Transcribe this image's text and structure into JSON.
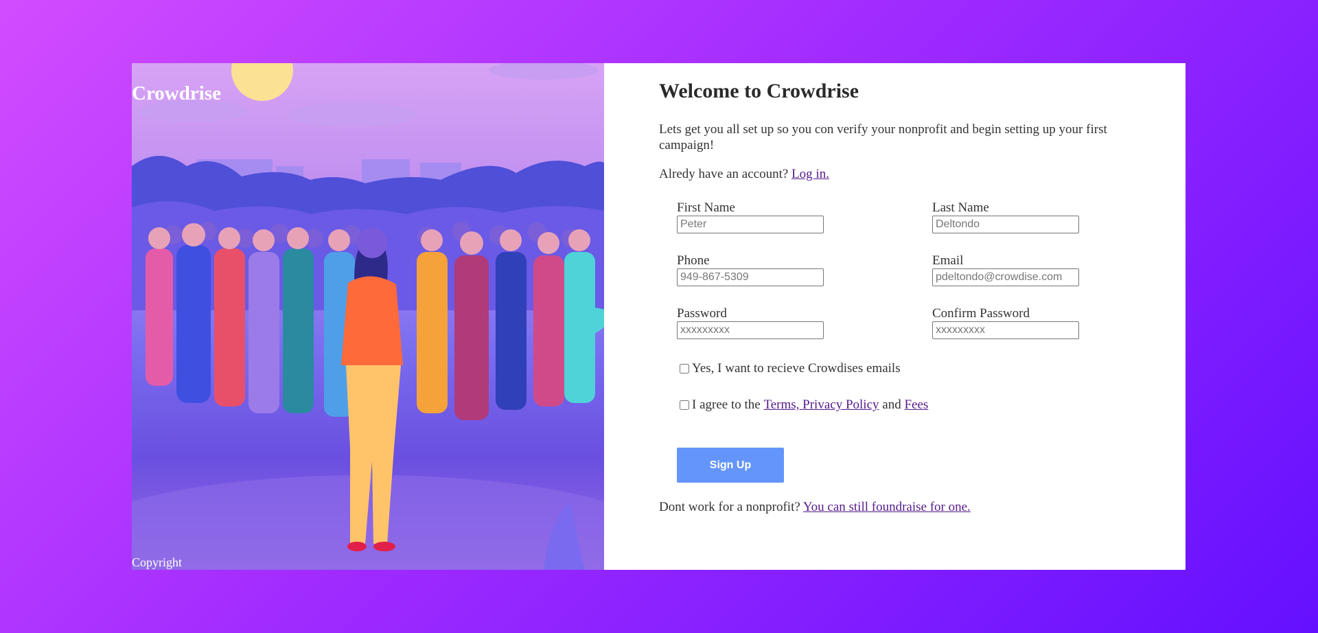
{
  "brand": "Crowdrise",
  "copyright": "Copyright",
  "form": {
    "title": "Welcome to Crowdrise",
    "intro": "Lets get you all set up so you con verify your nonprofit and begin setting up your first campaign!",
    "login_prompt": "Alredy have an account?",
    "login_link": "Log in.",
    "first_name": {
      "label": "First Name",
      "placeholder": "Peter"
    },
    "last_name": {
      "label": "Last Name",
      "placeholder": "Deltondo"
    },
    "phone": {
      "label": "Phone",
      "placeholder": "949-867-5309"
    },
    "email": {
      "label": "Email",
      "placeholder": "pdeltondo@crowdise.com"
    },
    "password": {
      "label": "Password",
      "placeholder": "xxxxxxxxx"
    },
    "confirm_password": {
      "label": "Confirm Password",
      "placeholder": "xxxxxxxxx"
    },
    "emails_opt_in": "Yes, I want to recieve Crowdises emails",
    "agree_prefix": "I agree to the",
    "terms_link": "Terms, Privacy Policy",
    "agree_and": "and",
    "fees_link": "Fees",
    "signup_button": "Sign Up",
    "bottom_prompt": "Dont work for a nonprofit?",
    "bottom_link": "You can still foundraise for one."
  },
  "colors": {
    "background_start": "#d24cff",
    "background_end": "#6410ff",
    "button": "#6495fb",
    "link": "#551a8b"
  }
}
